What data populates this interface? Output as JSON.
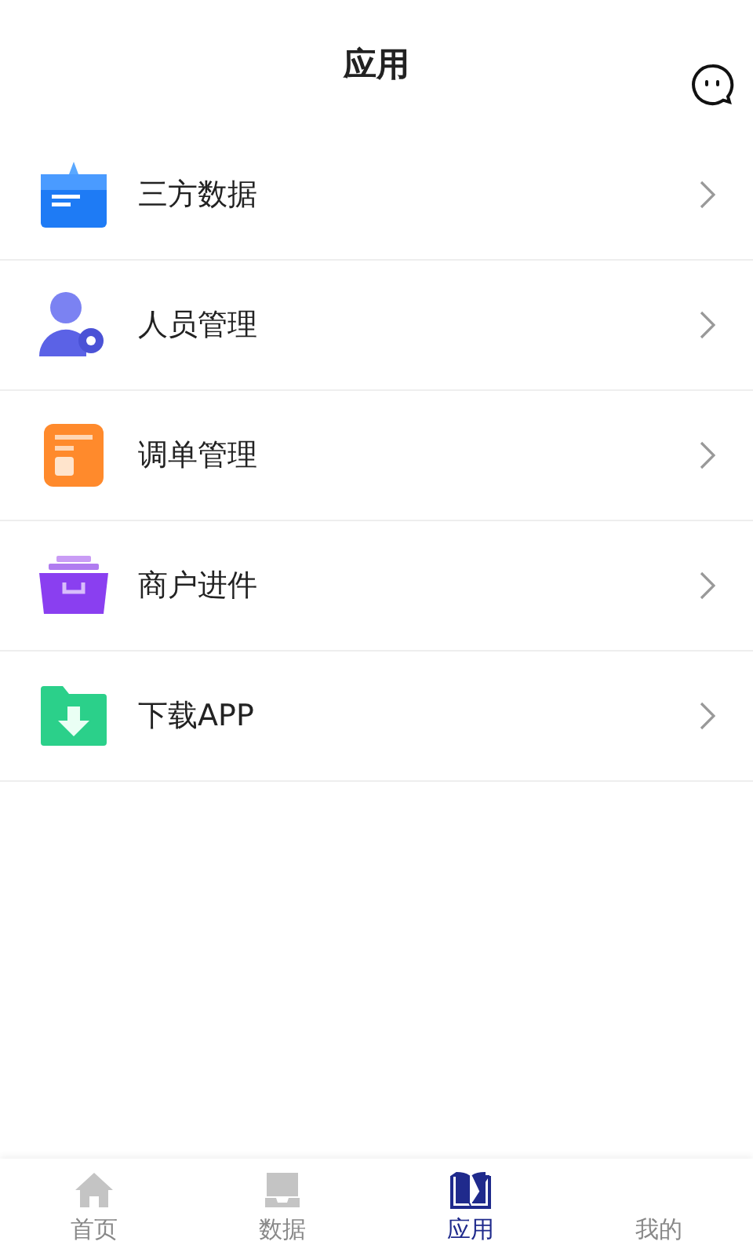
{
  "header": {
    "title": "应用"
  },
  "items": [
    {
      "kind": "data",
      "label": "三方数据"
    },
    {
      "kind": "people",
      "label": "人员管理"
    },
    {
      "kind": "order",
      "label": "调单管理"
    },
    {
      "kind": "merchant",
      "label": "商户进件"
    },
    {
      "kind": "download",
      "label": "下载APP"
    }
  ],
  "tabs": [
    {
      "kind": "home",
      "label": "首页",
      "selected": false
    },
    {
      "kind": "tray",
      "label": "数据",
      "selected": false
    },
    {
      "kind": "book",
      "label": "应用",
      "selected": true
    },
    {
      "kind": "none",
      "label": "我的",
      "selected": false
    }
  ]
}
